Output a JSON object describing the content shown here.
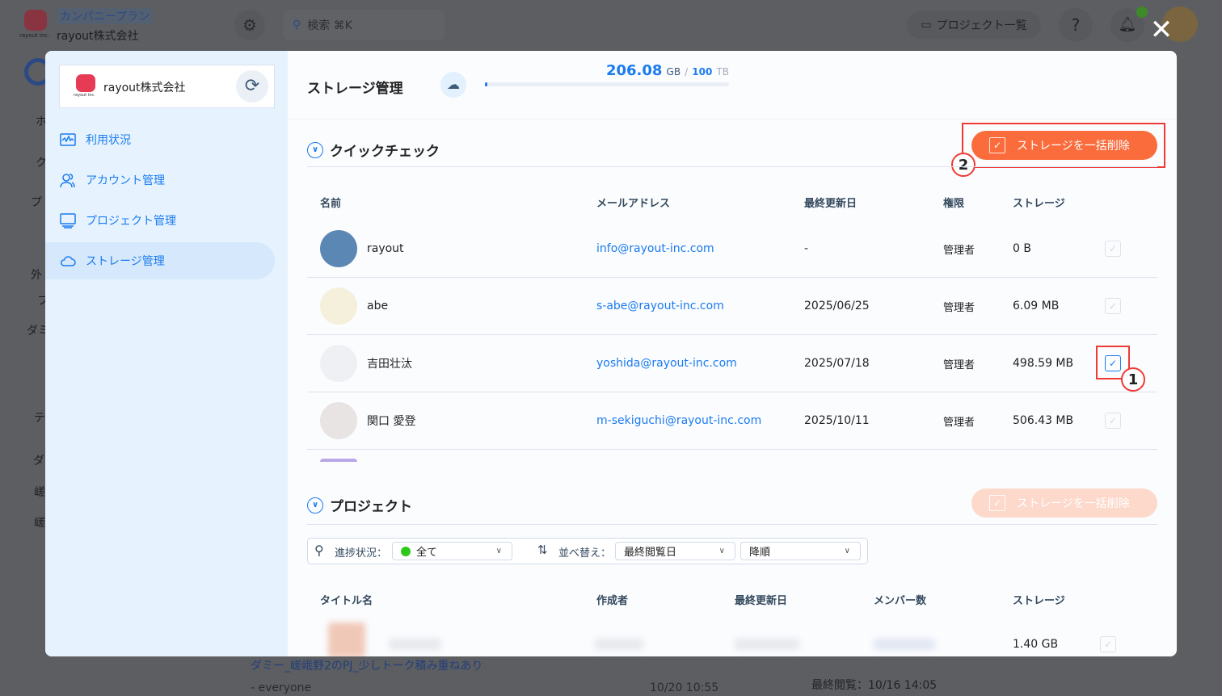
{
  "background": {
    "plan_badge": "カンパニープラン",
    "company_name": "rayout株式会社",
    "logo_text": "rayout inc.",
    "search_placeholder": "検索 ⌘K",
    "project_list_button": "プロジェクト一覧",
    "sidebar_fragments": [
      "ホ",
      "ク",
      "プ",
      "外",
      "フ",
      "ダミ",
      "テ",
      "ダ",
      "嵯",
      "嵯"
    ],
    "bottom_project_title": "ダミー_嵯峨野2のPJ_少しトーク積み重ねあり",
    "bottom_member": "- everyone",
    "bottom_time": "10/20 10:55",
    "bottom_last_viewed": "最終閲覧：10/16 14:05"
  },
  "modal": {
    "sidebar": {
      "company_name": "rayout株式会社",
      "logo_text": "rayout inc.",
      "items": [
        {
          "label": "利用状況",
          "icon": "activity-icon"
        },
        {
          "label": "アカウント管理",
          "icon": "users-icon"
        },
        {
          "label": "プロジェクト管理",
          "icon": "monitor-icon"
        },
        {
          "label": "ストレージ管理",
          "icon": "cloud-icon",
          "active": true
        }
      ]
    },
    "header": {
      "title": "ストレージ管理",
      "used_value": "206.08",
      "used_unit": "GB",
      "separator": "/",
      "total_value": "100",
      "total_unit": "TB",
      "usage_fraction": 0.002
    },
    "quick_check": {
      "title": "クイックチェック",
      "bulk_delete_label": "ストレージを一括削除",
      "columns": [
        "名前",
        "メールアドレス",
        "最終更新日",
        "権限",
        "ストレージ"
      ],
      "rows": [
        {
          "name": "rayout",
          "email": "info@rayout-inc.com",
          "updated": "-",
          "role": "管理者",
          "storage": "0 B",
          "checked": false
        },
        {
          "name": "abe",
          "email": "s-abe@rayout-inc.com",
          "updated": "2025/06/25",
          "role": "管理者",
          "storage": "6.09 MB",
          "checked": false
        },
        {
          "name": "吉田壮汰",
          "email": "yoshida@rayout-inc.com",
          "updated": "2025/07/18",
          "role": "管理者",
          "storage": "498.59 MB",
          "checked": true
        },
        {
          "name": "関口 愛登",
          "email": "m-sekiguchi@rayout-inc.com",
          "updated": "2025/10/11",
          "role": "管理者",
          "storage": "506.43 MB",
          "checked": false
        }
      ]
    },
    "projects": {
      "title": "プロジェクト",
      "bulk_delete_label": "ストレージを一括削除",
      "status_label": "進捗状況：",
      "status_value": "全て",
      "sort_label": "並べ替え：",
      "sort_value": "最終閲覧日",
      "order_value": "降順",
      "columns": [
        "タイトル名",
        "作成者",
        "最終更新日",
        "メンバー数",
        "ストレージ"
      ],
      "rows": [
        {
          "storage": "1.40 GB"
        }
      ]
    },
    "annotations": [
      "1",
      "2"
    ]
  },
  "colors": {
    "accent": "#1a7bf0",
    "danger": "#fb6c3d",
    "annotation": "#f03a35",
    "status_green": "#2ec918"
  }
}
